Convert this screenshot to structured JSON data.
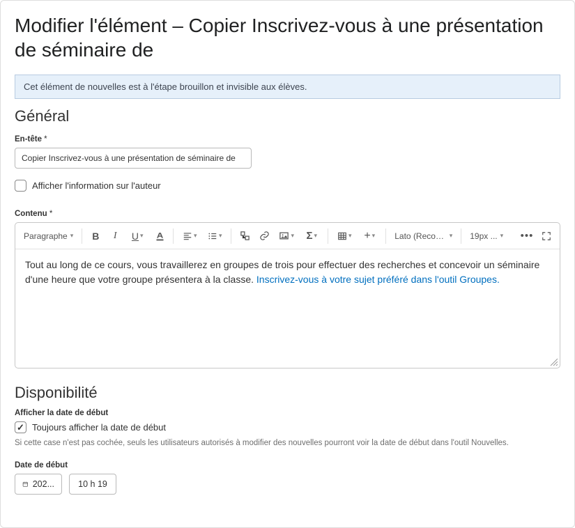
{
  "page": {
    "title": "Modifier l'élément – Copier Inscrivez-vous à une présentation de séminaire de"
  },
  "banner": {
    "text": "Cet élément de nouvelles est à l'étape brouillon et invisible aux élèves."
  },
  "sections": {
    "general": "Général",
    "availability": "Disponibilité"
  },
  "fields": {
    "headline_label": "En-tête",
    "headline_value": "Copier Inscrivez-vous à une présentation de séminaire de",
    "show_author_label": "Afficher l'information sur l'auteur",
    "show_author_checked": false,
    "content_label": "Contenu",
    "show_start_date_label": "Afficher la date de début",
    "always_show_start_label": "Toujours afficher la date de début",
    "always_show_start_checked": true,
    "always_show_start_help": "Si cette case n'est pas cochée, seuls les utilisateurs autorisés à modifier des nouvelles pourront voir la date de début dans l'outil Nouvelles.",
    "start_date_label": "Date de début",
    "start_date_value": "202...",
    "start_time_value": "10 h 19"
  },
  "editor": {
    "paragraph_label": "Paragraphe",
    "font_label": "Lato (Recom...",
    "size_label": "19px ...",
    "body_text": "Tout au long de ce cours, vous travaillerez en groupes de trois pour effectuer des recherches et concevoir un séminaire d'une heure que votre groupe présentera à la classe. ",
    "body_link": "Inscrivez-vous à votre sujet préféré dans l'outil Groupes."
  }
}
